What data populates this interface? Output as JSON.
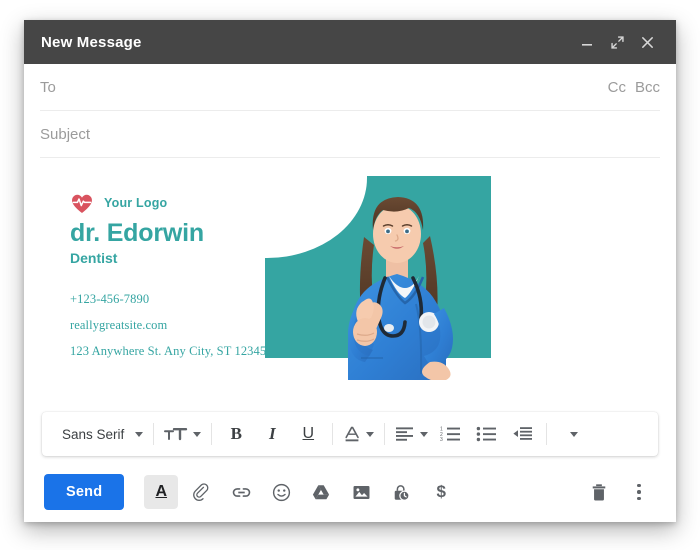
{
  "window": {
    "title": "New Message",
    "controls": [
      {
        "name": "minimize-button",
        "icon": "minimize-icon"
      },
      {
        "name": "expand-button",
        "icon": "expand-icon"
      },
      {
        "name": "close-button",
        "icon": "close-icon"
      }
    ]
  },
  "fields": {
    "to": {
      "placeholder": "To",
      "value": ""
    },
    "subject": {
      "placeholder": "Subject",
      "value": ""
    },
    "cc_label": "Cc",
    "bcc_label": "Bcc"
  },
  "signature": {
    "logo_text": "Your Logo",
    "logo_icon": "heart-pulse-icon",
    "name": "dr. Edorwin",
    "role": "Dentist",
    "phone": "+123-456-7890",
    "website": "reallygreatsite.com",
    "address": "123 Anywhere St. Any City, ST 12345",
    "accent_color": "#35a5a2",
    "logo_color": "#d9535f",
    "photo_alt": "nurse-thumbs-up-photo"
  },
  "format_toolbar": {
    "font_name": "Sans Serif",
    "items": [
      {
        "name": "font-family-dropdown",
        "label": "Sans Serif"
      },
      {
        "name": "font-size-dropdown",
        "label": ""
      },
      {
        "name": "bold-button",
        "label": "B"
      },
      {
        "name": "italic-button",
        "label": "I"
      },
      {
        "name": "underline-button",
        "label": "U"
      },
      {
        "name": "text-color-dropdown",
        "label": "A"
      },
      {
        "name": "align-dropdown",
        "label": ""
      },
      {
        "name": "numbered-list-button",
        "label": ""
      },
      {
        "name": "bulleted-list-button",
        "label": ""
      },
      {
        "name": "indent-less-button",
        "label": ""
      },
      {
        "name": "more-format-dropdown",
        "label": ""
      }
    ]
  },
  "action_bar": {
    "send_label": "Send",
    "send_color": "#1a73e8",
    "icons": [
      {
        "name": "formatting-options-icon",
        "label": "A"
      },
      {
        "name": "attach-file-icon",
        "label": ""
      },
      {
        "name": "insert-link-icon",
        "label": ""
      },
      {
        "name": "insert-emoji-icon",
        "label": ""
      },
      {
        "name": "insert-drive-icon",
        "label": ""
      },
      {
        "name": "insert-photo-icon",
        "label": ""
      },
      {
        "name": "confidential-mode-icon",
        "label": ""
      },
      {
        "name": "insert-money-icon",
        "label": "$"
      }
    ],
    "right_icons": [
      {
        "name": "discard-draft-icon",
        "label": ""
      },
      {
        "name": "more-options-icon",
        "label": ""
      }
    ]
  }
}
